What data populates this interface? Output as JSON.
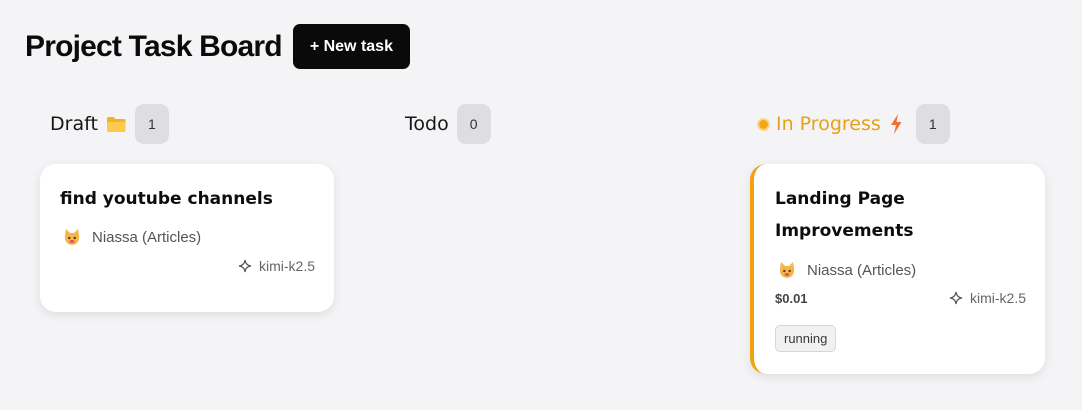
{
  "header": {
    "title": "Project Task Board",
    "new_task_label": "+ New task"
  },
  "columns": [
    {
      "title": "Draft",
      "icon": "folder-icon",
      "count": "1"
    },
    {
      "title": "Todo",
      "count": "0"
    },
    {
      "title": "In Progress",
      "icon": "lightning-icon",
      "count": "1",
      "accent": "#f2a20f"
    }
  ],
  "cards": [
    {
      "title": "find youtube channels",
      "assignee": "Niassa (Articles)",
      "model": "kimi-k2.5"
    },
    {
      "title": "Landing Page Improvements",
      "assignee": "Niassa (Articles)",
      "model": "kimi-k2.5",
      "cost": "$0.01",
      "status": "running"
    }
  ]
}
